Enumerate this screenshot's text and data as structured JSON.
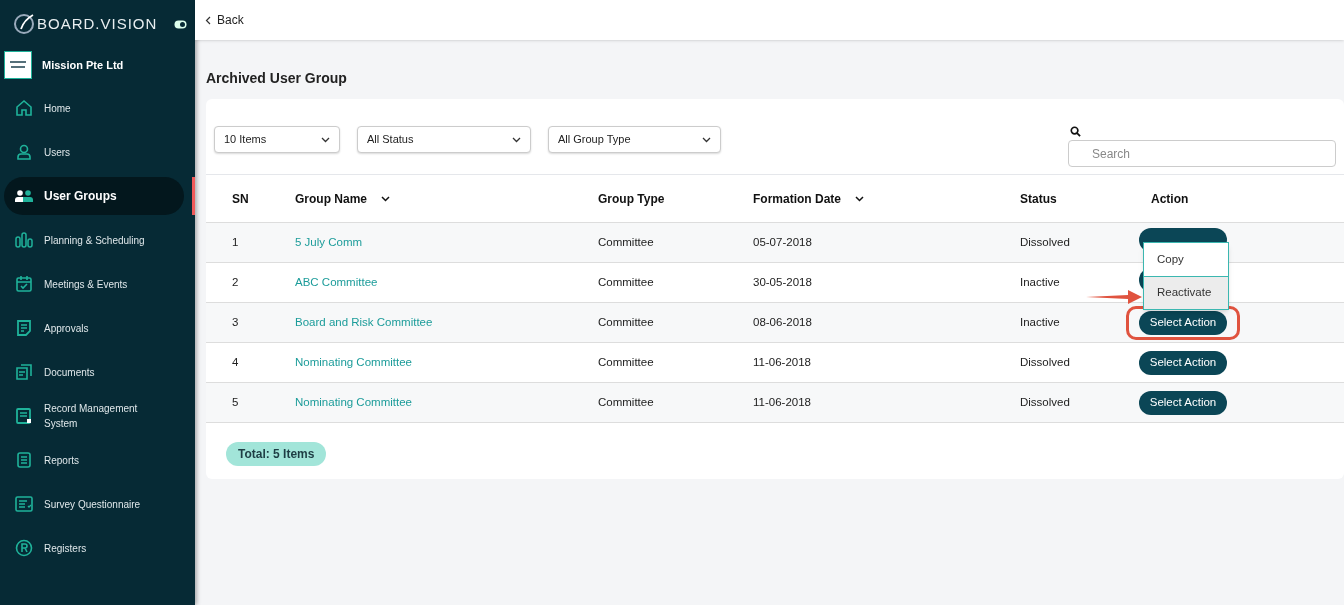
{
  "brand": {
    "name": "BOARD.VISION"
  },
  "org": {
    "name": "Mission Pte Ltd"
  },
  "sidebar": {
    "items": [
      {
        "label": "Home",
        "selected": false
      },
      {
        "label": "Users",
        "selected": false
      },
      {
        "label": "User Groups",
        "selected": true
      },
      {
        "label": "Planning & Scheduling",
        "selected": false
      },
      {
        "label": "Meetings & Events",
        "selected": false
      },
      {
        "label": "Approvals",
        "selected": false
      },
      {
        "label": "Documents",
        "selected": false
      },
      {
        "label": "Record Management System",
        "selected": false
      },
      {
        "label": "Reports",
        "selected": false
      },
      {
        "label": "Survey Questionnaire",
        "selected": false
      },
      {
        "label": "Registers",
        "selected": false
      }
    ]
  },
  "topbar": {
    "back": "Back"
  },
  "page_title": "Archived User Group",
  "filters": [
    "10 Items",
    "All Status",
    "All Group Type"
  ],
  "search": {
    "placeholder": "Search"
  },
  "table": {
    "columns": [
      {
        "label": "SN",
        "sortable": false
      },
      {
        "label": "Group Name",
        "sortable": true
      },
      {
        "label": "Group Type",
        "sortable": false
      },
      {
        "label": "Formation Date",
        "sortable": true
      },
      {
        "label": "Status",
        "sortable": false
      },
      {
        "label": "Action",
        "sortable": false
      }
    ],
    "rows": [
      {
        "sn": "1",
        "name": "5 July Comm",
        "type": "Committee",
        "date": "05-07-2018",
        "status": "Dissolved",
        "highlighted": false
      },
      {
        "sn": "2",
        "name": "ABC Committee",
        "type": "Committee",
        "date": "30-05-2018",
        "status": "Inactive",
        "highlighted": false
      },
      {
        "sn": "3",
        "name": "Board and Risk Committee",
        "type": "Committee",
        "date": "08-06-2018",
        "status": "Inactive",
        "action": "Select Action",
        "highlighted": true
      },
      {
        "sn": "4",
        "name": "Nominating Committee",
        "type": "Committee",
        "date": "11-06-2018",
        "status": "Dissolved",
        "action": "Select Action",
        "highlighted": false
      },
      {
        "sn": "5",
        "name": "Nominating Committee",
        "type": "Committee",
        "date": "11-06-2018",
        "status": "Dissolved",
        "action": "Select Action",
        "highlighted": false
      }
    ]
  },
  "action_menu": {
    "items": [
      {
        "label": "Copy",
        "pointed": false
      },
      {
        "label": "Reactivate",
        "pointed": true
      }
    ]
  },
  "total": "Total: 5 Items"
}
